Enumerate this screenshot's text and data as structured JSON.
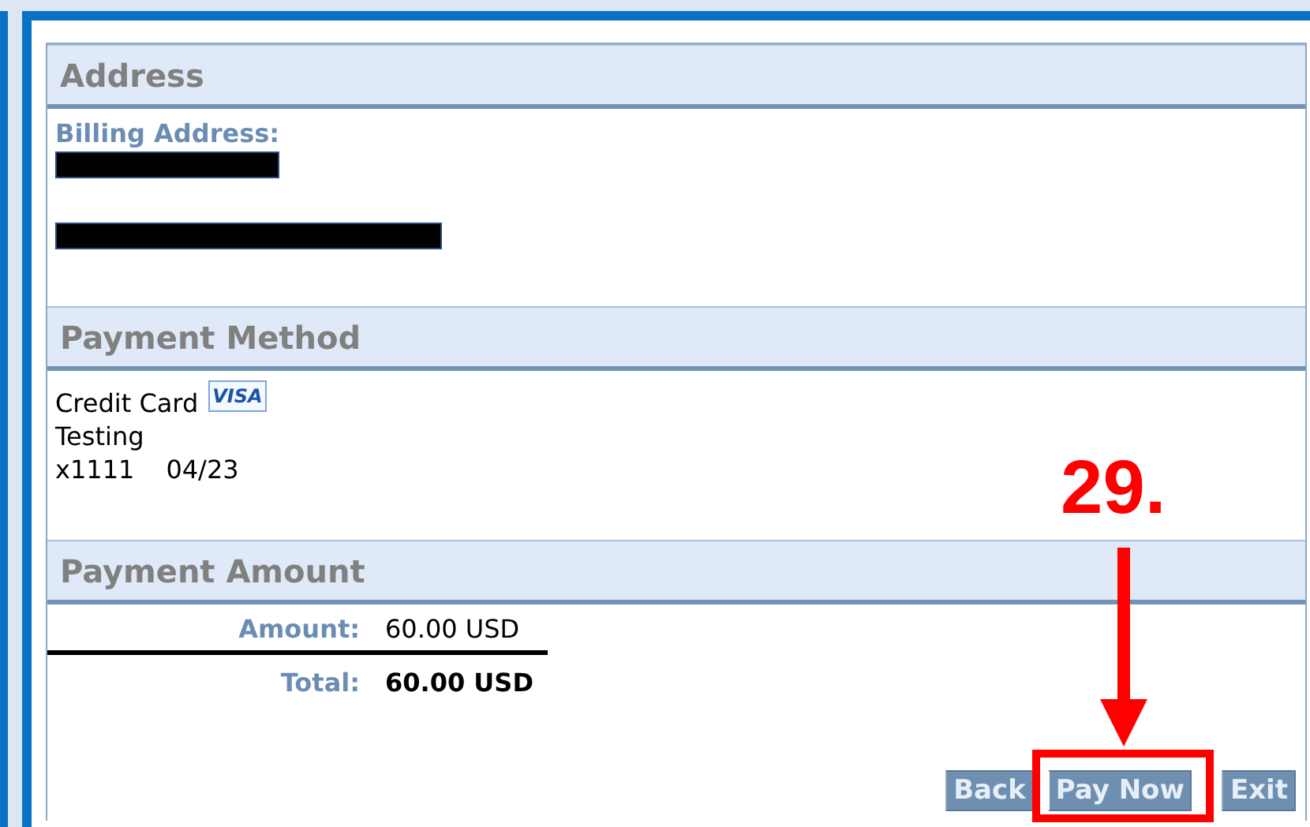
{
  "sections": [
    {
      "kind": "address",
      "title": "Address",
      "billing_label": "Billing Address:"
    },
    {
      "kind": "payment_method",
      "title": "Payment Method",
      "method": "Credit Card",
      "card_brand": "VISA",
      "card_name": "Testing",
      "card_number": "x1111",
      "card_expiry": "04/23"
    },
    {
      "kind": "payment_amount",
      "title": "Payment Amount",
      "amount_label": "Amount:",
      "amount_value": "60.00 USD",
      "total_label": "Total:",
      "total_value": "60.00 USD"
    }
  ],
  "buttons": [
    {
      "label": "Back",
      "highlighted": false
    },
    {
      "label": "Pay Now",
      "highlighted": true
    },
    {
      "label": "Exit",
      "highlighted": false
    }
  ],
  "annotation": {
    "label": "29."
  }
}
